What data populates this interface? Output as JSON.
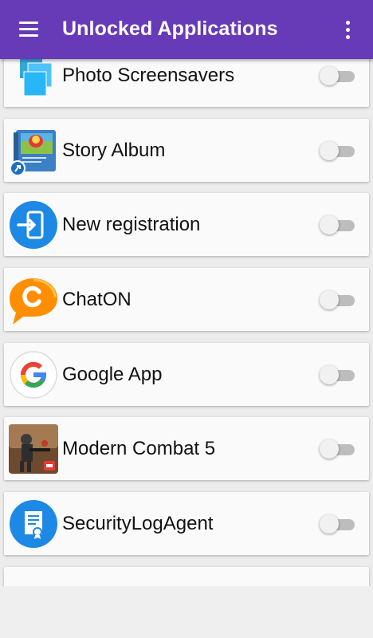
{
  "app_bar": {
    "title": "Unlocked Applications",
    "background_color": "#673ab7",
    "menu_icon": "hamburger-menu-icon",
    "overflow_icon": "more-vert-icon"
  },
  "apps": [
    {
      "label": "Photo Screensavers",
      "icon": "photo-screensavers-icon",
      "enabled": false
    },
    {
      "label": "Story Album",
      "icon": "story-album-icon",
      "enabled": false
    },
    {
      "label": "New registration",
      "icon": "new-registration-icon",
      "enabled": false
    },
    {
      "label": "ChatON",
      "icon": "chaton-icon",
      "enabled": false
    },
    {
      "label": "Google App",
      "icon": "google-app-icon",
      "enabled": false
    },
    {
      "label": "Modern Combat 5",
      "icon": "modern-combat-5-icon",
      "enabled": false
    },
    {
      "label": "SecurityLogAgent",
      "icon": "security-log-agent-icon",
      "enabled": false
    },
    {
      "label": "",
      "icon": "android-app-icon",
      "enabled": false
    }
  ]
}
